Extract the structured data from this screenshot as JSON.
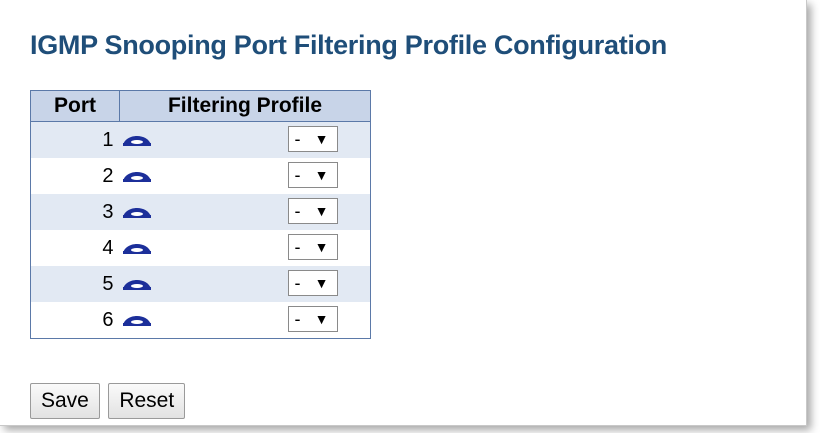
{
  "page": {
    "title": "IGMP Snooping Port Filtering Profile Configuration"
  },
  "table": {
    "headers": {
      "port": "Port",
      "profile": "Filtering Profile"
    },
    "rows": [
      {
        "port": "1",
        "profile": "-"
      },
      {
        "port": "2",
        "profile": "-"
      },
      {
        "port": "3",
        "profile": "-"
      },
      {
        "port": "4",
        "profile": "-"
      },
      {
        "port": "5",
        "profile": "-"
      },
      {
        "port": "6",
        "profile": "-"
      }
    ]
  },
  "buttons": {
    "save": "Save",
    "reset": "Reset"
  },
  "colors": {
    "title": "#1f4e79",
    "header_bg": "#c8d4e8",
    "row_alt_bg": "#e2e9f3",
    "eye_icon": "#1c2f9a",
    "border": "#5b79a8"
  }
}
